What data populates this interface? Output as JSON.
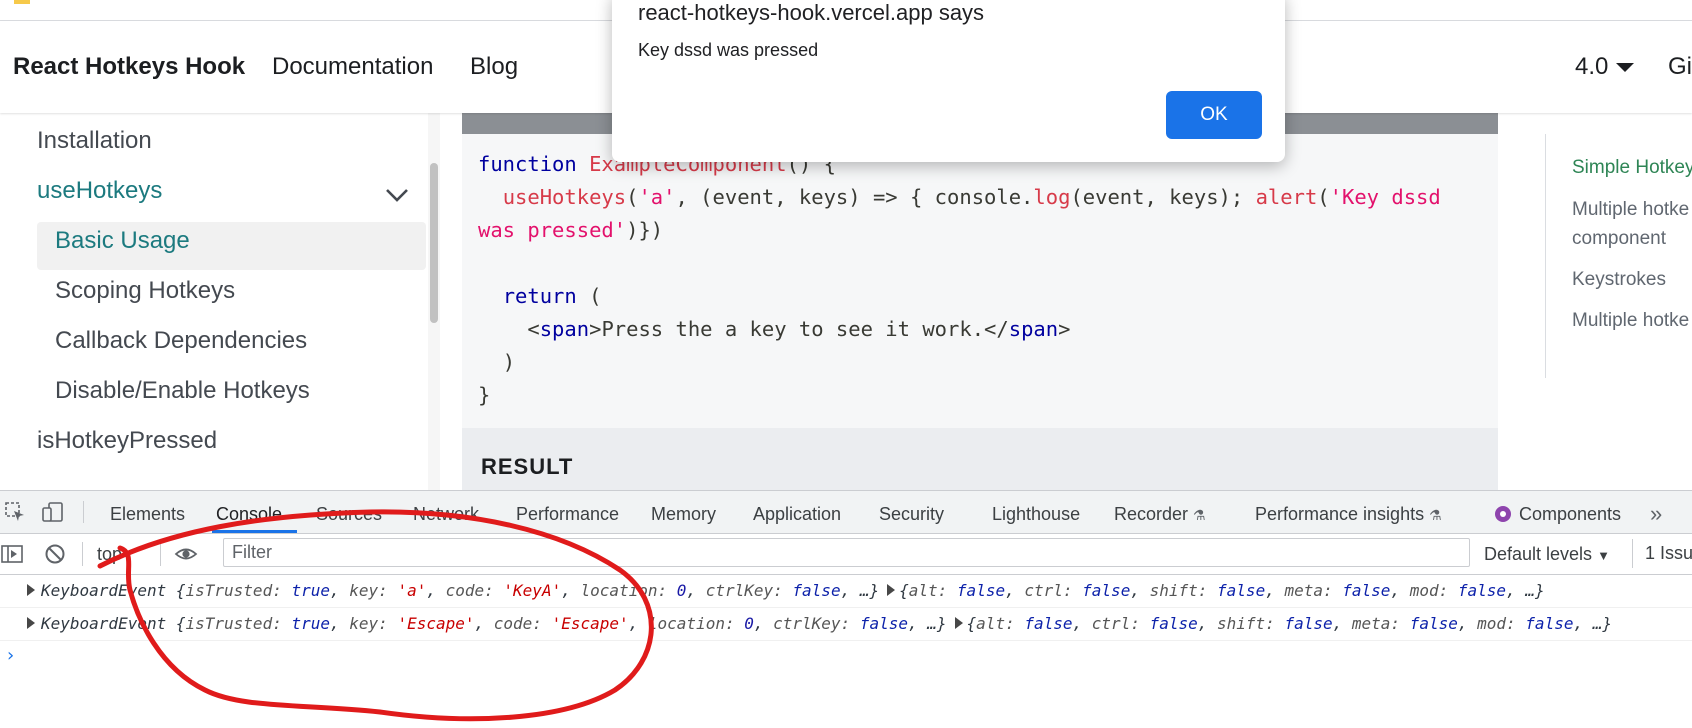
{
  "navbar": {
    "brand": "React Hotkeys Hook",
    "links": [
      "Documentation",
      "Blog"
    ],
    "version": "4.0",
    "github_partial": "Gi"
  },
  "sidebar": {
    "items": [
      {
        "label": "Installation"
      },
      {
        "label": "useHotkeys"
      },
      {
        "label": "Basic Usage"
      },
      {
        "label": "Scoping Hotkeys"
      },
      {
        "label": "Callback Dependencies"
      },
      {
        "label": "Disable/Enable Hotkeys"
      },
      {
        "label": "isHotkeyPressed"
      }
    ]
  },
  "code": {
    "line1_kw": "function",
    "line1_fn": "ExampleComponent",
    "line1_rest": "() {",
    "line2_fn": "useHotkeys",
    "line2_str": "'a'",
    "line2_mid": ", (event, keys) => { console.",
    "line2_log": "log",
    "line2_args": "(event, keys); ",
    "line2_alert": "alert",
    "line2_alertstr1": "'Key dssd",
    "line3_str": "was pressed'",
    "line3_rest": ")})",
    "line5_kw": "return",
    "line5_rest": " (",
    "line6_open_tag": "span",
    "line6_text": "Press the a key to see it work.",
    "line6_close_tag": "span",
    "line7": ")",
    "line8": "}"
  },
  "result_label": "RESULT",
  "toc": {
    "items": [
      "Simple Hotkey",
      "Multiple hotke",
      "component",
      "Keystrokes",
      "Multiple hotke"
    ]
  },
  "alert": {
    "title": "react-hotkeys-hook.vercel.app says",
    "message": "Key dssd was pressed",
    "ok_label": "OK"
  },
  "devtools": {
    "tabs": [
      "Elements",
      "Console",
      "Sources",
      "Network",
      "Performance",
      "Memory",
      "Application",
      "Security",
      "Lighthouse",
      "Recorder",
      "Performance insights",
      "Components"
    ],
    "more": "»",
    "context": "top",
    "filter_placeholder": "Filter",
    "levels": "Default levels",
    "issues": "1 Issu",
    "log": [
      {
        "type": "KeyboardEvent",
        "key": "'a'",
        "code": "'KeyA'"
      },
      {
        "type": "KeyboardEvent",
        "key": "'Escape'",
        "code": "'Escape'"
      }
    ],
    "prompt": "›"
  },
  "colors": {
    "accent_teal": "#1c7a7f",
    "devtools_blue": "#1a73e8",
    "annotation_red": "#e01b1b"
  }
}
